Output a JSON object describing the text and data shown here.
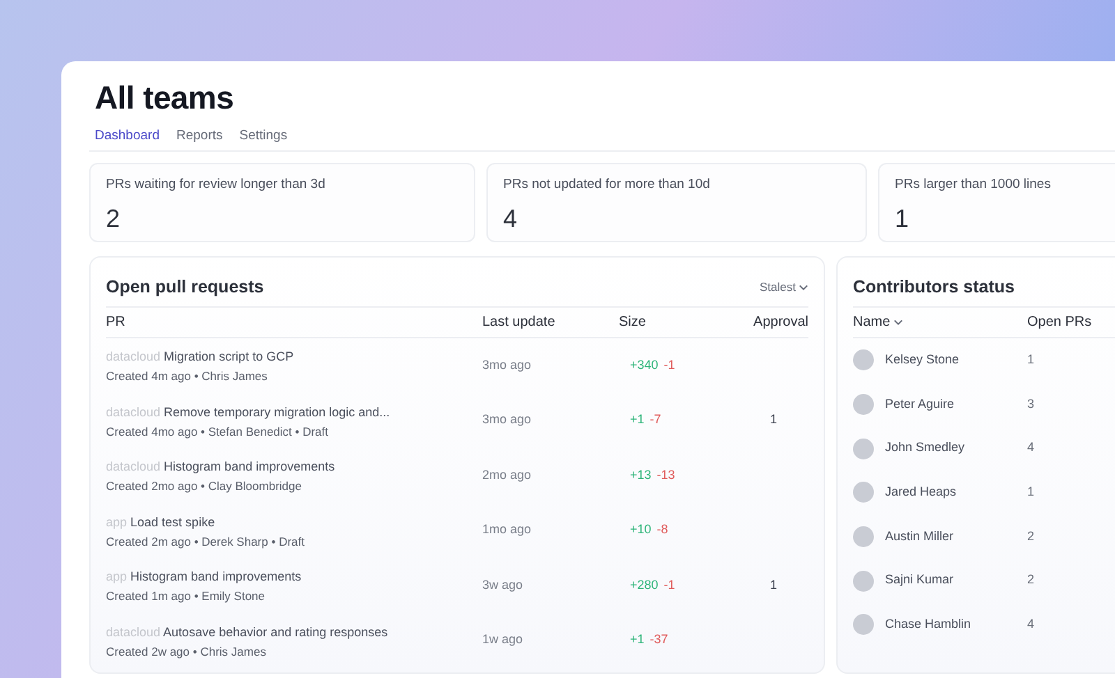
{
  "page": {
    "title": "All teams"
  },
  "tabs": [
    {
      "label": "Dashboard",
      "selected": true
    },
    {
      "label": "Reports",
      "selected": false
    },
    {
      "label": "Settings",
      "selected": false
    }
  ],
  "stats": [
    {
      "label": "PRs waiting for review longer than 3d",
      "value": "2"
    },
    {
      "label": "PRs not updated for more than 10d",
      "value": "4"
    },
    {
      "label": "PRs larger than 1000 lines",
      "value": "1"
    }
  ],
  "pull_requests": {
    "title": "Open pull requests",
    "sort": "Stalest",
    "columns": [
      "PR",
      "Last update",
      "Size",
      "Approval"
    ],
    "rows": [
      {
        "repo": "datacloud",
        "title": "Migration script to GCP",
        "meta": "Created 4m ago • Chris James",
        "last_update": "3mo ago",
        "added": "+340",
        "removed": "-1"
      },
      {
        "repo": "datacloud",
        "title": "Remove temporary migration logic and...",
        "meta": "Created 4mo ago • Stefan Benedict • Draft",
        "last_update": "3mo ago",
        "added": "+1",
        "removed": "-7",
        "approval": "1"
      },
      {
        "repo": "datacloud",
        "title": "Histogram band improvements",
        "meta": "Created 2mo ago • Clay Bloombridge",
        "last_update": "2mo ago",
        "added": "+13",
        "removed": "-13"
      },
      {
        "repo": "app",
        "title": "Load test spike",
        "meta": "Created 2m ago • Derek Sharp • Draft",
        "last_update": "1mo ago",
        "added": "+10",
        "removed": "-8"
      },
      {
        "repo": "app",
        "title": "Histogram band improvements",
        "meta": "Created 1m ago • Emily Stone",
        "last_update": "3w ago",
        "added": "+280",
        "removed": "-1",
        "approval": "1"
      },
      {
        "repo": "datacloud",
        "title": "Autosave behavior and rating responses",
        "meta": "Created 2w ago • Chris James",
        "last_update": "1w ago",
        "added": "+1",
        "removed": "-37"
      }
    ]
  },
  "contributors": {
    "title": "Contributors status",
    "columns": [
      "Name",
      "Open PRs"
    ],
    "rows": [
      {
        "name": "Kelsey Stone",
        "open_prs": "1"
      },
      {
        "name": "Peter Aguire",
        "open_prs": "3"
      },
      {
        "name": "John Smedley",
        "open_prs": "4"
      },
      {
        "name": "Jared Heaps",
        "open_prs": "1"
      },
      {
        "name": "Austin Miller",
        "open_prs": "2"
      },
      {
        "name": "Sajni Kumar",
        "open_prs": "2"
      },
      {
        "name": "Chase Hamblin",
        "open_prs": "4"
      }
    ]
  }
}
